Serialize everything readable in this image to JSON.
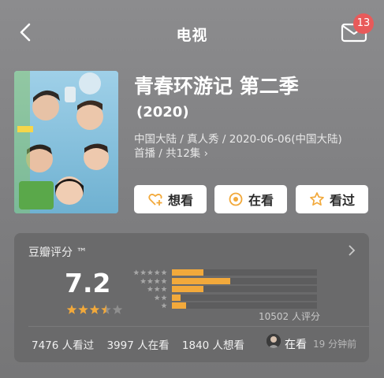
{
  "header": {
    "title": "电视",
    "mail_badge": "13"
  },
  "show": {
    "title": "青春环游记 第二季",
    "year": "(2020)",
    "meta_line1": "中国大陆 / 真人秀 / 2020-06-06(中国大陆)",
    "meta_line2": "首播 / 共12集 ›"
  },
  "actions": {
    "want": "想看",
    "watching": "在看",
    "watched": "看过"
  },
  "rating": {
    "label": "豆瓣评分 ™",
    "score": "7.2",
    "score_stars": 3.5,
    "distribution": [
      {
        "stars": 5,
        "fraction": 0.22
      },
      {
        "stars": 4,
        "fraction": 0.4
      },
      {
        "stars": 3,
        "fraction": 0.22
      },
      {
        "stars": 2,
        "fraction": 0.06
      },
      {
        "stars": 1,
        "fraction": 0.1
      }
    ],
    "votes": "10502 人评分"
  },
  "stats": {
    "watched": "7476 人看过",
    "watching": "3997 人在看",
    "want": "1840 人想看"
  },
  "activity": {
    "state": "在看",
    "time": "19 分钟前"
  },
  "colors": {
    "accent": "#f2a93b",
    "badge": "#e85a5a"
  }
}
